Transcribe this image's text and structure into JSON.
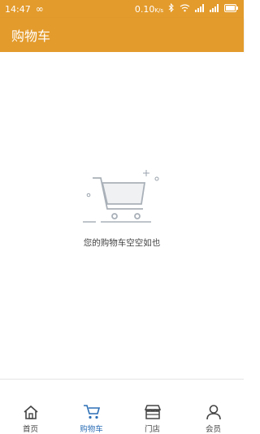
{
  "status": {
    "time": "14:47",
    "left_icon": "infinity-icon",
    "speed": "0.10",
    "speed_unit": "K/s",
    "battery": "battery-icon"
  },
  "appbar": {
    "title": "购物车"
  },
  "empty": {
    "message": "您的购物车空空如也",
    "icon": "empty-cart-illustration"
  },
  "tabs": [
    {
      "label": "首页",
      "icon": "home-icon",
      "active": false
    },
    {
      "label": "购物车",
      "icon": "cart-icon",
      "active": true
    },
    {
      "label": "门店",
      "icon": "store-icon",
      "active": false
    },
    {
      "label": "会员",
      "icon": "user-icon",
      "active": false
    }
  ],
  "colors": {
    "brand": "#e39b2c",
    "active_tab": "#2d6fb6"
  }
}
